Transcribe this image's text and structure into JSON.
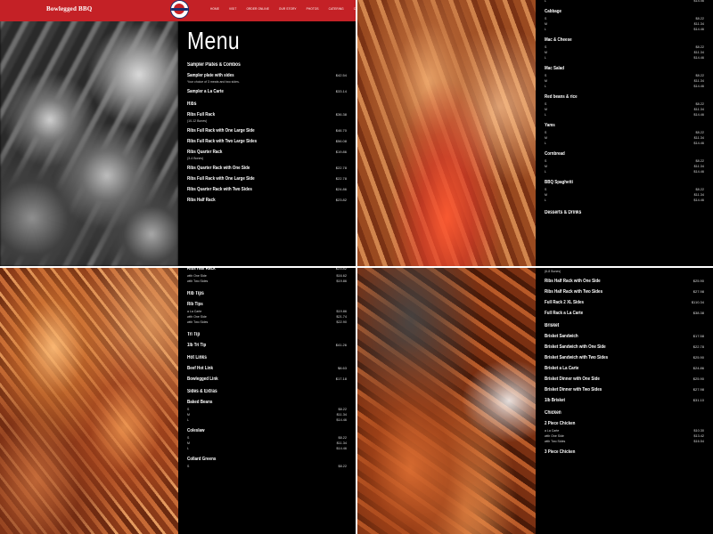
{
  "nav": {
    "brand": "Bowlegged BBQ",
    "links": [
      "HOME",
      "VISIT",
      "ORDER ONLINE",
      "OUR STORY",
      "PHOTOS",
      "CATERING",
      "CONTACT US"
    ]
  },
  "menu_title": "Menu",
  "q1": [
    {
      "type": "cat",
      "text": "Sampler Plates & Combos"
    },
    {
      "type": "item",
      "name": "Sampler plate with sides",
      "price": "$42.54",
      "note": "Your choice of 3 meats and two sides."
    },
    {
      "type": "item",
      "name": "Sampler a La Carte",
      "price": "$33.14"
    },
    {
      "type": "cat",
      "text": "Ribs"
    },
    {
      "type": "item",
      "name": "Ribs Full Rack",
      "price": "$36.38",
      "note": "(10-12 Bones)"
    },
    {
      "type": "item",
      "name": "Ribs Full Rack with One Large Side",
      "price": "$46.70"
    },
    {
      "type": "item",
      "name": "Ribs Full Rack with Two Large Sides",
      "price": "$56.08"
    },
    {
      "type": "item",
      "name": "Ribs Quarter Rack",
      "price": "$19.86",
      "note": "(3-4 Bones)"
    },
    {
      "type": "item",
      "name": "Ribs Quarter Rack with One Side",
      "price": "$22.78"
    },
    {
      "type": "item",
      "name": "Ribs Full Rack with One Large Side",
      "price": "$22.78"
    },
    {
      "type": "item",
      "name": "Ribs Quarter Rack with Two Sides",
      "price": "$24.86"
    },
    {
      "type": "item",
      "name": "Ribs Half Rack",
      "price": "$23.82"
    }
  ],
  "q2": [
    {
      "type": "sizes",
      "rows": [
        [
          "L",
          "$14.46"
        ]
      ]
    },
    {
      "type": "item",
      "name": "Cabbage",
      "price": ""
    },
    {
      "type": "sizes",
      "rows": [
        [
          "S",
          "$8.22"
        ],
        [
          "M",
          "$11.34"
        ],
        [
          "L",
          "$14.46"
        ]
      ]
    },
    {
      "type": "item",
      "name": "Mac & Cheese",
      "price": ""
    },
    {
      "type": "sizes",
      "rows": [
        [
          "S",
          "$8.22"
        ],
        [
          "M",
          "$11.34"
        ],
        [
          "L",
          "$14.46"
        ]
      ]
    },
    {
      "type": "item",
      "name": "Mac Salad",
      "price": ""
    },
    {
      "type": "sizes",
      "rows": [
        [
          "S",
          "$8.22"
        ],
        [
          "M",
          "$11.34"
        ],
        [
          "L",
          "$14.46"
        ]
      ]
    },
    {
      "type": "item",
      "name": "Red beans & rice",
      "price": ""
    },
    {
      "type": "sizes",
      "rows": [
        [
          "S",
          "$8.22"
        ],
        [
          "M",
          "$11.34"
        ],
        [
          "L",
          "$14.46"
        ]
      ]
    },
    {
      "type": "item",
      "name": "Yams",
      "price": ""
    },
    {
      "type": "sizes",
      "rows": [
        [
          "S",
          "$8.22"
        ],
        [
          "M",
          "$11.34"
        ],
        [
          "L",
          "$14.46"
        ]
      ]
    },
    {
      "type": "item",
      "name": "Cornbread",
      "price": ""
    },
    {
      "type": "sizes",
      "rows": [
        [
          "S",
          "$8.22"
        ],
        [
          "M",
          "$11.34"
        ],
        [
          "L",
          "$14.46"
        ]
      ]
    },
    {
      "type": "item",
      "name": "BBQ Spaghetti",
      "price": ""
    },
    {
      "type": "sizes",
      "rows": [
        [
          "S",
          "$8.22"
        ],
        [
          "M",
          "$11.34"
        ],
        [
          "L",
          "$14.46"
        ]
      ]
    },
    {
      "type": "cat",
      "text": "Desserts & Drinks"
    }
  ],
  "q3": [
    {
      "type": "item",
      "name": "Ribs Half Rack",
      "price": "$23.82"
    },
    {
      "type": "sizes",
      "rows": [
        [
          "with One Side",
          "$16.62"
        ],
        [
          "with Two Sides",
          "$19.86"
        ]
      ]
    },
    {
      "type": "cat",
      "text": "Rib Tips"
    },
    {
      "type": "item",
      "name": "Rib Tips",
      "price": ""
    },
    {
      "type": "sizes",
      "rows": [
        [
          "a La Carte",
          "$19.86"
        ],
        [
          "with One Side",
          "$21.74"
        ],
        [
          "with Two Sides",
          "$22.90"
        ]
      ]
    },
    {
      "type": "cat",
      "text": "Tri Tip"
    },
    {
      "type": "item",
      "name": "1lb Tri Tip",
      "price": "$41.26"
    },
    {
      "type": "cat",
      "text": "Hot Links"
    },
    {
      "type": "item",
      "name": "Beef Hot Link",
      "price": "$8.63"
    },
    {
      "type": "item",
      "name": "Bowlegged Link",
      "price": "$17.18"
    },
    {
      "type": "cat",
      "text": "Sides & Extras"
    },
    {
      "type": "item",
      "name": "Baked Beans",
      "price": ""
    },
    {
      "type": "sizes",
      "rows": [
        [
          "S",
          "$8.22"
        ],
        [
          "M",
          "$11.34"
        ],
        [
          "L",
          "$14.46"
        ]
      ]
    },
    {
      "type": "item",
      "name": "Coleslaw",
      "price": ""
    },
    {
      "type": "sizes",
      "rows": [
        [
          "S",
          "$8.22"
        ],
        [
          "M",
          "$11.34"
        ],
        [
          "L",
          "$14.46"
        ]
      ]
    },
    {
      "type": "item",
      "name": "Collard Greens",
      "price": ""
    },
    {
      "type": "sizes",
      "rows": [
        [
          "S",
          "$8.22"
        ]
      ]
    }
  ],
  "q4": [
    {
      "type": "note",
      "text": "(6-8 Bones)"
    },
    {
      "type": "item",
      "name": "Ribs Half Rack with One Side",
      "price": "$25.90"
    },
    {
      "type": "item",
      "name": "Ribs Half Rack with Two Sides",
      "price": "$27.98"
    },
    {
      "type": "item",
      "name": "Full Rack 2 XL Sides",
      "price": "$110.34"
    },
    {
      "type": "item",
      "name": "Full Rack a La Carte",
      "price": "$38.38"
    },
    {
      "type": "cat",
      "text": "Brisket"
    },
    {
      "type": "item",
      "name": "Brisket Sandwich",
      "price": "$17.58"
    },
    {
      "type": "item",
      "name": "Brisket Sandwich with One Side",
      "price": "$22.78"
    },
    {
      "type": "item",
      "name": "Brisket Sandwich with Two Sides",
      "price": "$25.90"
    },
    {
      "type": "item",
      "name": "Brisket a La Carte",
      "price": "$24.86"
    },
    {
      "type": "item",
      "name": "Brisket Dinner with One Side",
      "price": "$25.90"
    },
    {
      "type": "item",
      "name": "Brisket Dinner with Two Sides",
      "price": "$27.98"
    },
    {
      "type": "item",
      "name": "1lb Brisket",
      "price": "$31.10"
    },
    {
      "type": "cat",
      "text": "Chicken"
    },
    {
      "type": "item",
      "name": "2 Piece Chicken",
      "price": ""
    },
    {
      "type": "sizes",
      "rows": [
        [
          "a La Carte",
          "$10.30"
        ],
        [
          "with One Side",
          "$13.42"
        ],
        [
          "with Two Sides",
          "$16.54"
        ]
      ]
    },
    {
      "type": "item",
      "name": "3 Piece Chicken",
      "price": ""
    }
  ]
}
